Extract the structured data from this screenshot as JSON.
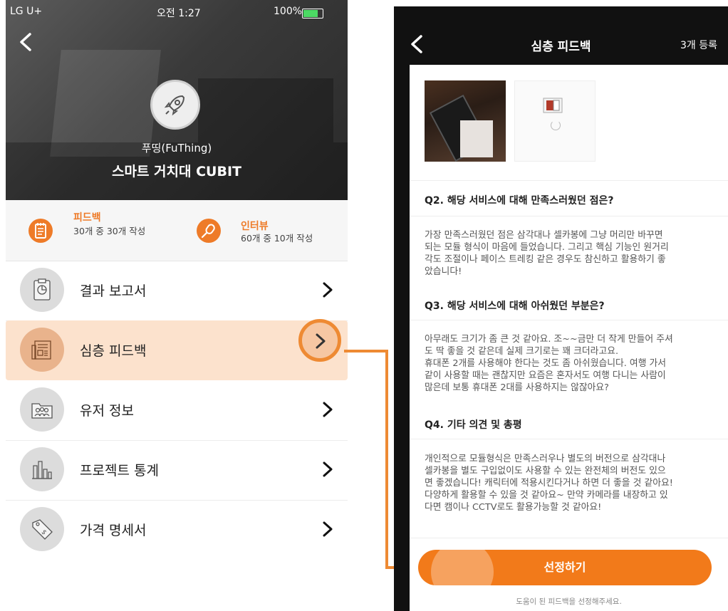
{
  "left": {
    "status_bar": {
      "carrier": "LG U+",
      "time": "오전 1:27",
      "battery": "100%"
    },
    "header": {
      "company": "푸띵(FuThing)",
      "product": "스마트 거치대 CUBIT"
    },
    "stats": [
      {
        "title": "피드백",
        "sub": "30개 중 30개 작성",
        "icon": "notepad-icon"
      },
      {
        "title": "인터뷰",
        "sub": "60개 중 10개 작성",
        "icon": "microphone-icon"
      }
    ],
    "menu": [
      {
        "label": "결과 보고서",
        "icon": "report-clipboard-icon"
      },
      {
        "label": "심층 피드백",
        "icon": "newspaper-icon",
        "active": true
      },
      {
        "label": "유저 정보",
        "icon": "users-folder-icon"
      },
      {
        "label": "프로젝트 통계",
        "icon": "bar-chart-icon"
      },
      {
        "label": "가격 명세서",
        "icon": "price-tag-icon"
      }
    ]
  },
  "right": {
    "nav": {
      "title": "심층 피드백",
      "right": "3개 등록"
    },
    "qa": [
      {
        "q": "Q2. 해당 서비스에 대해 만족스러웠던 점은?",
        "a": "가장 만족스러웠던 점은 삼각대나 셀카봉에 그냥 머리만 바꾸면\n되는 모듈 형식이 마음에 들었습니다. 그리고 핵심 기능인 원거리\n각도 조절이나 페이스 트레킹 같은 경우도 참신하고 활용하기 좋\n았습니다!"
      },
      {
        "q": "Q3. 해당 서비스에 대해 아쉬웠던 부분은?",
        "a": "아무래도 크기가 좀 큰 것 같아요. 조~~금만 더 작게 만들어 주셔\n도 딱 좋을 것 같은데 실제 크기로는 꽤 크더라고요.\n휴대폰 2개를 사용해야 한다는 것도 좀 아쉬웠습니다. 여행 가서\n같이 사용할 때는 괜찮지만 요즘은 혼자서도 여행 다니는 사람이\n많은데 보통 휴대폰 2대를 사용하지는 않잖아요?"
      },
      {
        "q": "Q4. 기타 의견 및 총평",
        "a": "개인적으로 모듈형식은 만족스러우나 별도의 버전으로 삼각대나\n셀카봉을 별도 구입없이도 사용할 수 있는 완전체의 버전도 있으\n면 좋겠습니다! 캐릭터에 적용시킨다거나 하면 더 좋을 것 같아요!\n다양하게 활용할 수 있을 것 같아요~ 만약 카메라를 내장하고 있\n다면 캠이나 CCTV로도 활용가능할 것 같아요!"
      }
    ],
    "select_button": "선정하기",
    "hint": "도움이 된 피드백을 선정해주세요."
  },
  "colors": {
    "accent": "#f27a1a",
    "active_bg": "#fce2cd",
    "ring": "#ee8a33"
  }
}
